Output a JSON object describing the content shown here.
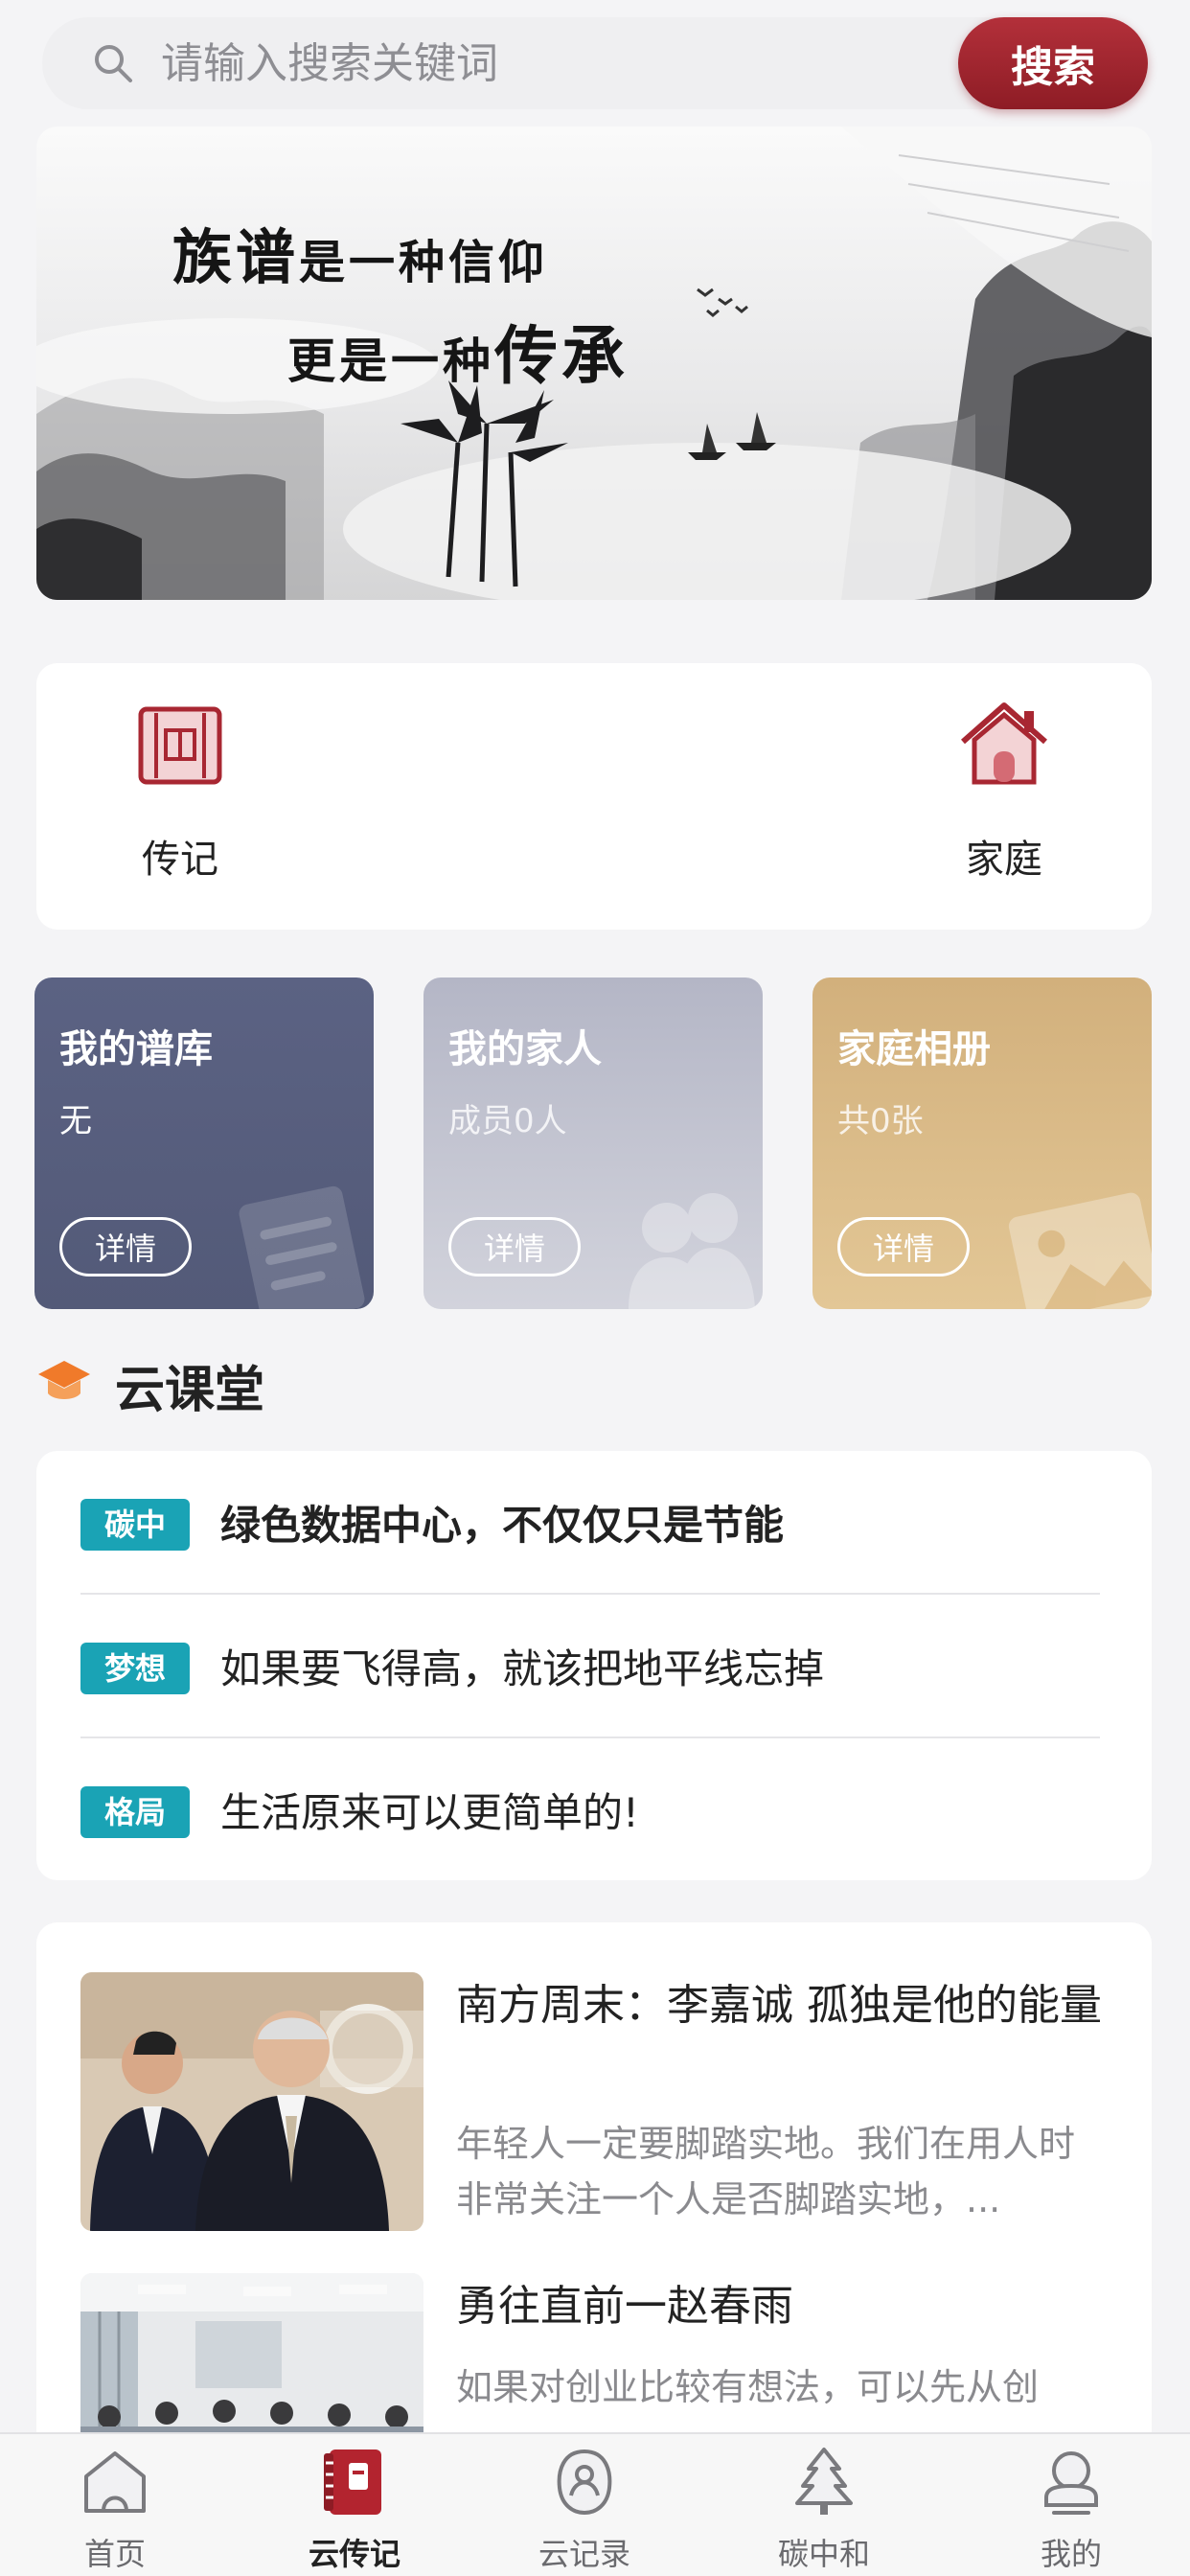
{
  "search": {
    "placeholder": "请输入搜索关键词",
    "button_label": "搜索",
    "icon": "search-icon"
  },
  "banner": {
    "line1_a": "族谱",
    "line1_b": "是一种信仰",
    "line2_a": "更是一种",
    "line2_b": "传承"
  },
  "quick_links": [
    {
      "label": "传记",
      "icon": "scroll-icon"
    },
    {
      "label": "家庭",
      "icon": "house-icon"
    }
  ],
  "tiles": [
    {
      "title": "我的谱库",
      "subtitle": "无",
      "button": "详情",
      "color": "#585f7f",
      "icon": "document-icon"
    },
    {
      "title": "我的家人",
      "subtitle": "成员0人",
      "button": "详情",
      "color": "#c3c4d1",
      "icon": "people-icon"
    },
    {
      "title": "家庭相册",
      "subtitle": "共0张",
      "button": "详情",
      "color": "#dabc88",
      "icon": "photo-icon"
    }
  ],
  "cloud_class": {
    "title": "云课堂",
    "icon": "graduation-cap-icon",
    "items": [
      {
        "tag": "碳中",
        "title": "绿色数据中心，不仅仅只是节能"
      },
      {
        "tag": "梦想",
        "title": "如果要飞得高，就该把地平线忘掉"
      },
      {
        "tag": "格局",
        "title": "生活原来可以更简单的!"
      }
    ],
    "tag_color": "#1aa3b5"
  },
  "articles": [
    {
      "title": "南方周末：李嘉诚 孤独是他的能量",
      "summary": "年轻人一定要脚踏实地。我们在用人时非常关注一个人是否脚踏实地，..."
    },
    {
      "title": "勇往直前一赵春雨",
      "summary": "如果对创业比较有想法，可以先从创"
    }
  ],
  "tabbar": {
    "items": [
      {
        "label": "首页",
        "icon": "home-icon",
        "active": false
      },
      {
        "label": "云传记",
        "icon": "book-icon",
        "active": true
      },
      {
        "label": "云记录",
        "icon": "record-icon",
        "active": false
      },
      {
        "label": "碳中和",
        "icon": "tree-icon",
        "active": false
      },
      {
        "label": "我的",
        "icon": "profile-icon",
        "active": false
      }
    ]
  },
  "colors": {
    "brand_red": "#9e2530",
    "teal_tag": "#1aa3b5",
    "section_orange": "#f07a2a"
  }
}
